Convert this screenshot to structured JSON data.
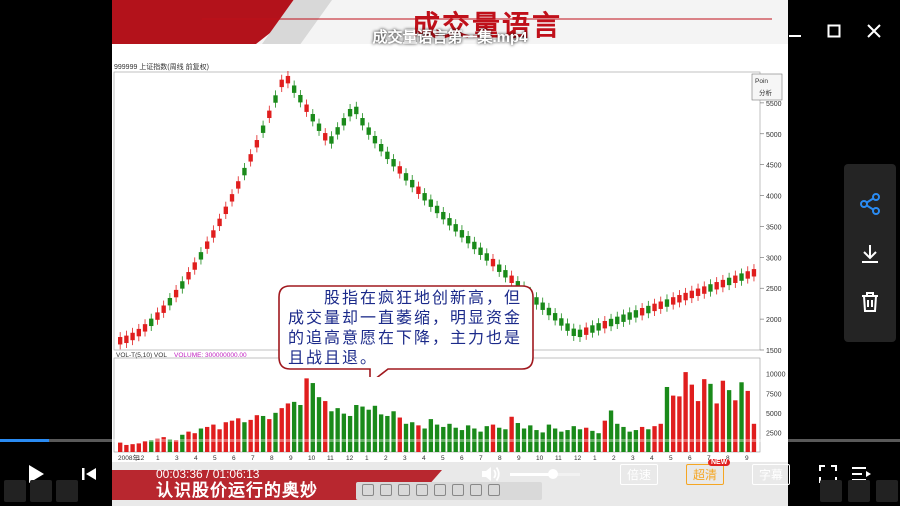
{
  "player": {
    "file_title": "成交量语言第一集.mp4",
    "current_time": "00:03:36",
    "total_time": "01:06:13",
    "time_separator": " / ",
    "progress": 0.054,
    "volume_level": 0.62,
    "speed_label": "倍速",
    "quality_label": "超清",
    "quality_badge": "NEW",
    "subtitle_label": "字幕",
    "accent_color": "#2a8bf2"
  },
  "slide": {
    "title": "成交量语言",
    "footer_text": "认识股价运行的奥妙"
  },
  "chart": {
    "header": "999999 上证指数(周线 前复权)",
    "vol_header": "VOL-T(5,10) VOL",
    "vol_value": "VOLUME: 300000000.00",
    "y_ticks": [
      "5500",
      "5000",
      "4500",
      "4000",
      "3500",
      "3000",
      "2500",
      "2000",
      "1500"
    ],
    "vol_ticks": [
      "10000",
      "7500",
      "5000",
      "2500"
    ],
    "x_ticks": [
      "2008年",
      "12",
      "1",
      "3",
      "4",
      "5",
      "6",
      "7",
      "8",
      "9",
      "10",
      "11",
      "12",
      "1",
      "2",
      "3",
      "4",
      "5",
      "6",
      "7",
      "8",
      "9",
      "10",
      "11",
      "12",
      "1",
      "2",
      "3",
      "4",
      "5",
      "6",
      "7",
      "8",
      "9"
    ],
    "zoom_label": "Poin",
    "zoom_sub": "分析",
    "callout": "股指在疯狂地创新高，但成交量却一直萎缩，明显资金的追高意愿在下降，主力也是且战且退。",
    "up_color": "#e01e1e",
    "down_color": "#1a8a1a"
  },
  "chart_data": {
    "type": "bar",
    "title": "999999 上证指数(周线 前复权)",
    "series": [
      {
        "name": "VOL",
        "values": [
          1200,
          900,
          1000,
          1100,
          1400,
          1500,
          1700,
          1900,
          1600,
          1500,
          2200,
          2600,
          2400,
          3000,
          3200,
          3500,
          2900,
          3800,
          4000,
          4300,
          3800,
          4100,
          4700,
          4600,
          4200,
          5000,
          5600,
          6200,
          6400,
          6000,
          9400,
          8800,
          7000,
          6500,
          5200,
          5600,
          4900,
          4600,
          6000,
          5800,
          5400,
          5900,
          4800,
          4600,
          5200,
          4400,
          3600,
          3800,
          3400,
          3000,
          4200,
          3500,
          3200,
          3600,
          3100,
          2800,
          3400,
          3000,
          2600,
          3300,
          3500,
          3100,
          2900,
          4500,
          3700,
          3000,
          3400,
          2800,
          2500,
          3500,
          3000,
          2600,
          2800,
          3300,
          2900,
          3100,
          2700,
          2400,
          4000,
          5300,
          3600,
          3200,
          2600,
          2800,
          3200,
          2900,
          3300,
          3600,
          8300,
          7200,
          7100,
          10200,
          8600,
          6500,
          9300,
          8700,
          6200,
          9100,
          7900,
          6600,
          8900,
          7800,
          3600
        ]
      }
    ],
    "ylim": [
      0,
      12000
    ],
    "price_ylim": [
      1500,
      6000
    ]
  }
}
